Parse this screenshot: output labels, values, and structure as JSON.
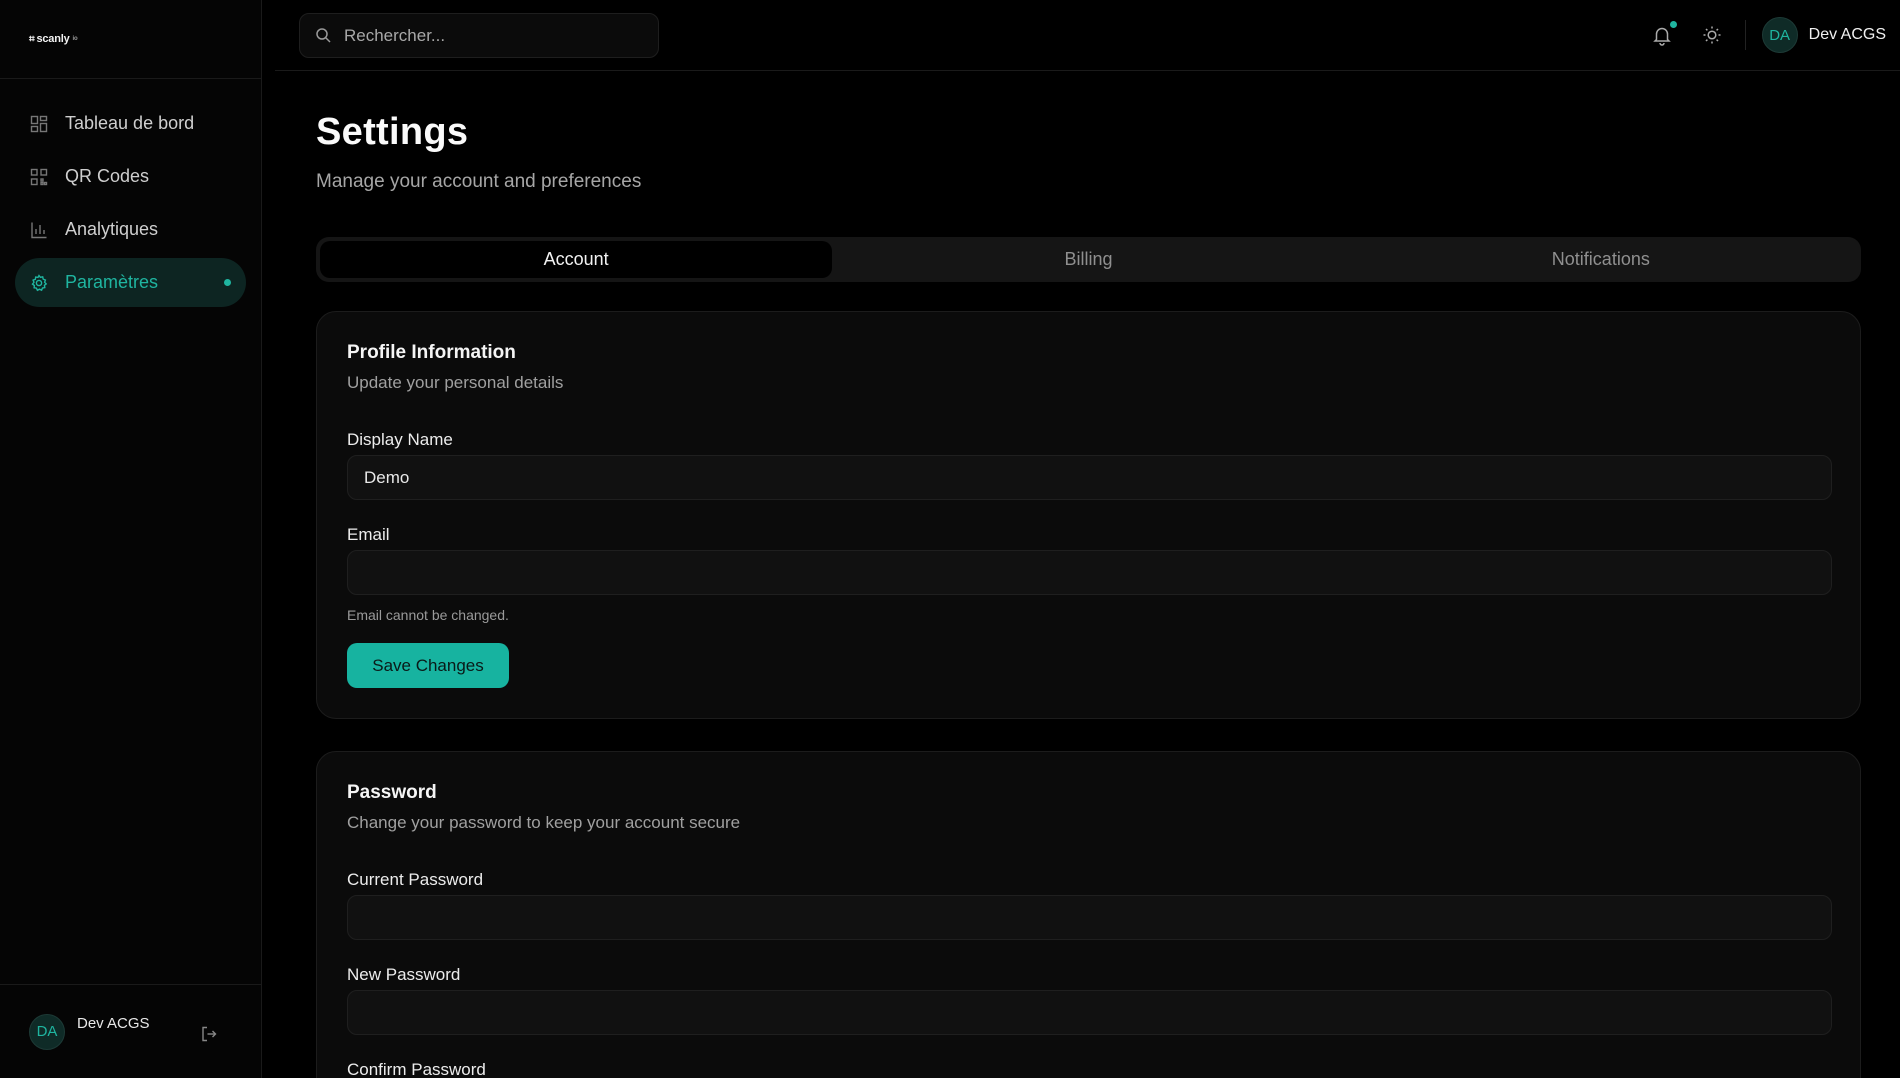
{
  "brand": {
    "logo_mark": "⌗",
    "logo_text": "scanly",
    "logo_tld": "io"
  },
  "sidebar": {
    "items": [
      {
        "label": "Tableau de bord",
        "icon": "dashboard-icon"
      },
      {
        "label": "QR Codes",
        "icon": "qr-code-icon"
      },
      {
        "label": "Analytiques",
        "icon": "bar-chart-icon"
      },
      {
        "label": "Paramètres",
        "icon": "gear-icon",
        "active": true
      }
    ],
    "footer": {
      "initials": "DA",
      "name": "Dev ACGS"
    }
  },
  "topbar": {
    "search_placeholder": "Rechercher...",
    "user": {
      "initials": "DA",
      "name": "Dev ACGS"
    }
  },
  "page": {
    "title": "Settings",
    "subtitle": "Manage your account and preferences"
  },
  "tabs": [
    {
      "label": "Account",
      "active": true
    },
    {
      "label": "Billing"
    },
    {
      "label": "Notifications"
    }
  ],
  "profile": {
    "title": "Profile Information",
    "subtitle": "Update your personal details",
    "display_name_label": "Display Name",
    "display_name_value": "Demo",
    "email_label": "Email",
    "email_value": "",
    "email_hint": "Email cannot be changed.",
    "save_label": "Save Changes"
  },
  "password": {
    "title": "Password",
    "subtitle": "Change your password to keep your account secure",
    "current_label": "Current Password",
    "new_label": "New Password",
    "confirm_label": "Confirm Password"
  },
  "colors": {
    "accent": "#1fb5a0",
    "background": "#000000",
    "card": "#0b0b0b"
  }
}
